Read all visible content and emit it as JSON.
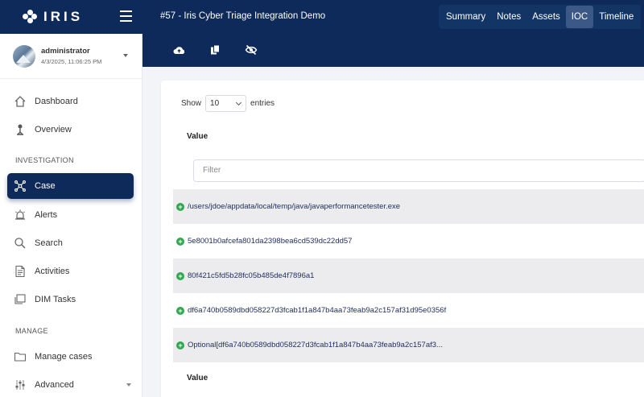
{
  "app": {
    "name": "IRIS"
  },
  "header": {
    "case_title": "#57 - Iris Cyber Triage Integration Demo",
    "tabs": [
      "Summary",
      "Notes",
      "Assets",
      "IOC",
      "Timeline"
    ],
    "active_tab": "IOC"
  },
  "user": {
    "name": "administrator",
    "date": "4/3/2025, 11:06:25 PM"
  },
  "sidebar": {
    "items_top": [
      {
        "label": "Dashboard",
        "icon": "home-icon"
      },
      {
        "label": "Overview",
        "icon": "overview-icon"
      }
    ],
    "section_investigation": "INVESTIGATION",
    "items_investigation": [
      {
        "label": "Case",
        "icon": "case-network-icon",
        "active": true
      },
      {
        "label": "Alerts",
        "icon": "alert-icon"
      },
      {
        "label": "Search",
        "icon": "search-icon"
      },
      {
        "label": "Activities",
        "icon": "activities-icon"
      },
      {
        "label": "DIM Tasks",
        "icon": "tasks-icon"
      }
    ],
    "section_manage": "MANAGE",
    "items_manage": [
      {
        "label": "Manage cases",
        "icon": "folder-icon"
      },
      {
        "label": "Advanced",
        "icon": "sliders-icon"
      }
    ]
  },
  "toolbar": {
    "icons": [
      "cloud-upload-icon",
      "copy-icon",
      "eye-slash-icon"
    ]
  },
  "table": {
    "show_label": "Show",
    "page_size": "10",
    "entries_label": "entries",
    "column_header": "Value",
    "filter_placeholder": "Filter",
    "rows": [
      "/users/jdoe/appdata/local/temp/java/javaperformancetester.exe",
      "5e8001b0afcefa801da2398bea6cd539dc22dd57",
      "80f421c5fd5b28fc05b485de4f7896a1",
      "df6a740b0589dbd058227d3fcab1f1a847b4aa73feab9a2c157af31d95e0356f",
      "Optional[df6a740b0589dbd058227d3fcab1f1a847b4aa73feab9a2c157af3..."
    ],
    "footer_header": "Value"
  },
  "colors": {
    "navy": "#0d2a5a",
    "expand_green": "#2fa84f"
  }
}
